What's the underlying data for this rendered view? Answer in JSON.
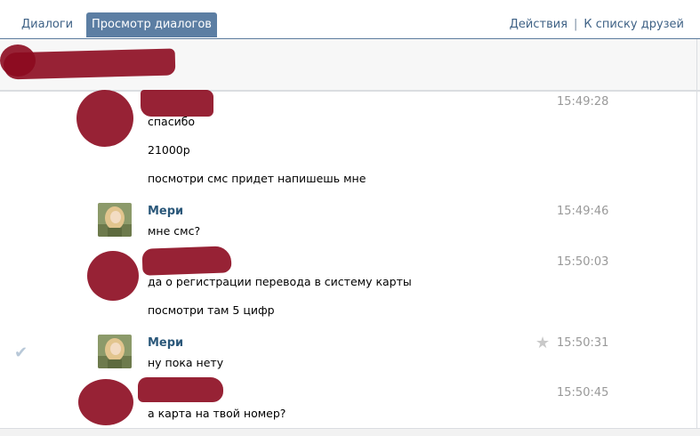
{
  "tabs": {
    "dialogs": "Диалоги",
    "view": "Просмотр диалогов"
  },
  "top_links": {
    "actions": "Действия",
    "separator": "|",
    "friends": "К списку друзей"
  },
  "messages": [
    {
      "author": "",
      "time": "15:49:28",
      "lines": [
        "спасибо",
        "21000р",
        "посмотри смс придет напишешь мне"
      ]
    },
    {
      "author": "Мери",
      "time": "15:49:46",
      "lines": [
        "мне смс?"
      ]
    },
    {
      "author": "",
      "time": "15:50:03",
      "lines": [
        "да о регистрации перевода в систему карты",
        "посмотри там 5 цифр"
      ]
    },
    {
      "author": "Мери",
      "time": "15:50:31",
      "lines": [
        "ну пока нету"
      ]
    },
    {
      "author": "",
      "time": "15:50:45",
      "lines": [
        "а карта на твой номер?"
      ]
    }
  ],
  "icons": {
    "selected": "check-icon",
    "favorite": "star-icon"
  },
  "colors": {
    "redaction": "#8c0a1f",
    "link": "#2b587a",
    "tab_active": "#5c7ea3",
    "time": "#999999"
  }
}
